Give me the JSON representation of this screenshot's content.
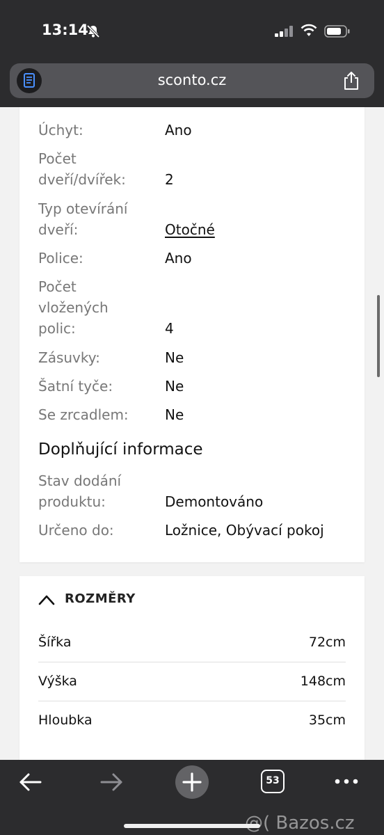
{
  "status_bar": {
    "time": "13:14"
  },
  "browser": {
    "url": "sconto.cz",
    "tab_count": "53"
  },
  "specs_card": {
    "rows": [
      {
        "label": "Úchyt:",
        "value": "Ano"
      },
      {
        "label_lines": [
          "Počet",
          "dveří/dvířek:"
        ],
        "value": "2"
      },
      {
        "label_lines": [
          "Typ otevírání",
          "dveří:"
        ],
        "value": "Otočné"
      },
      {
        "label": "Police:",
        "value": "Ano"
      },
      {
        "label_lines": [
          "Počet",
          "vložených",
          "polic:"
        ],
        "value": "4"
      },
      {
        "label": "Zásuvky:",
        "value": "Ne"
      },
      {
        "label": "Šatní tyče:",
        "value": "Ne"
      },
      {
        "label": "Se zrcadlem:",
        "value": "Ne"
      }
    ],
    "additional_heading": "Doplňující informace",
    "additional_rows": [
      {
        "label_lines": [
          "Stav dodání",
          "produktu:"
        ],
        "value": "Demontováno"
      },
      {
        "label": "Určeno do:",
        "value": "Ložnice, Obývací pokoj"
      }
    ]
  },
  "dimensions_card": {
    "title": "ROZMĚRY",
    "rows": [
      {
        "label": "Šířka",
        "value": "72cm"
      },
      {
        "label": "Výška",
        "value": "148cm"
      },
      {
        "label": "Hloubka",
        "value": "35cm"
      }
    ]
  },
  "watermark": "@( Bazos.cz"
}
